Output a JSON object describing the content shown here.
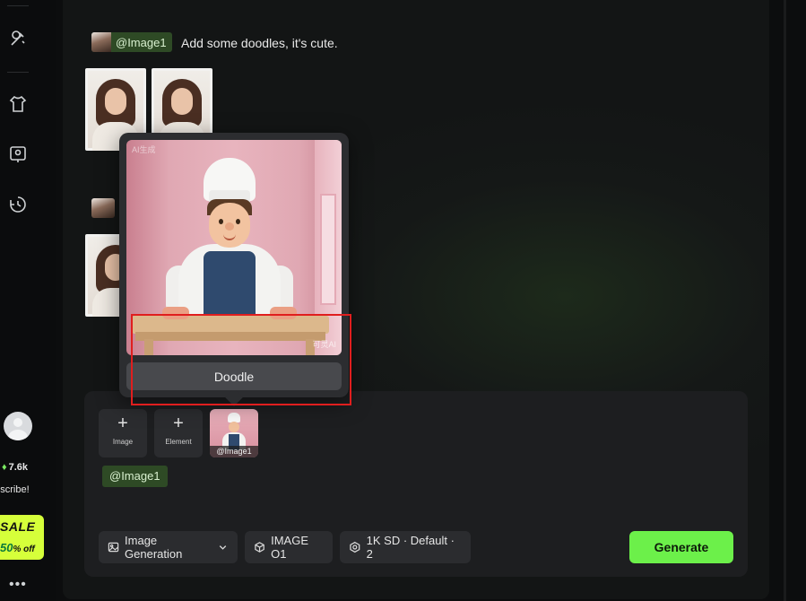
{
  "sidebar": {
    "icons": [
      "magic-wand-icon",
      "shirt-icon",
      "idea-board-icon",
      "history-icon"
    ],
    "credits": "7.6k",
    "subscribe_label": "ubscribe!",
    "sale": {
      "label": "SALE",
      "percent": "50",
      "off": "% off"
    },
    "more": "•••"
  },
  "chat": {
    "mention": "@Image1",
    "prompt": "Add some doodles, it's cute."
  },
  "popover": {
    "watermark_top": "AI生成",
    "watermark_bottom": "可灵AI",
    "action_label": "Doodle"
  },
  "composer": {
    "tiles": [
      {
        "label": "Image"
      },
      {
        "label": "Element"
      }
    ],
    "ref_label": "@Image1",
    "mention_chip": "@Image1",
    "controls": {
      "mode": "Image Generation",
      "model": "IMAGE O1",
      "settings": "1K SD · Default · 2"
    },
    "generate_label": "Generate"
  },
  "colors": {
    "accent": "#6cf04a",
    "chip_bg": "#2e4a25",
    "highlight": "#e01e1e"
  }
}
